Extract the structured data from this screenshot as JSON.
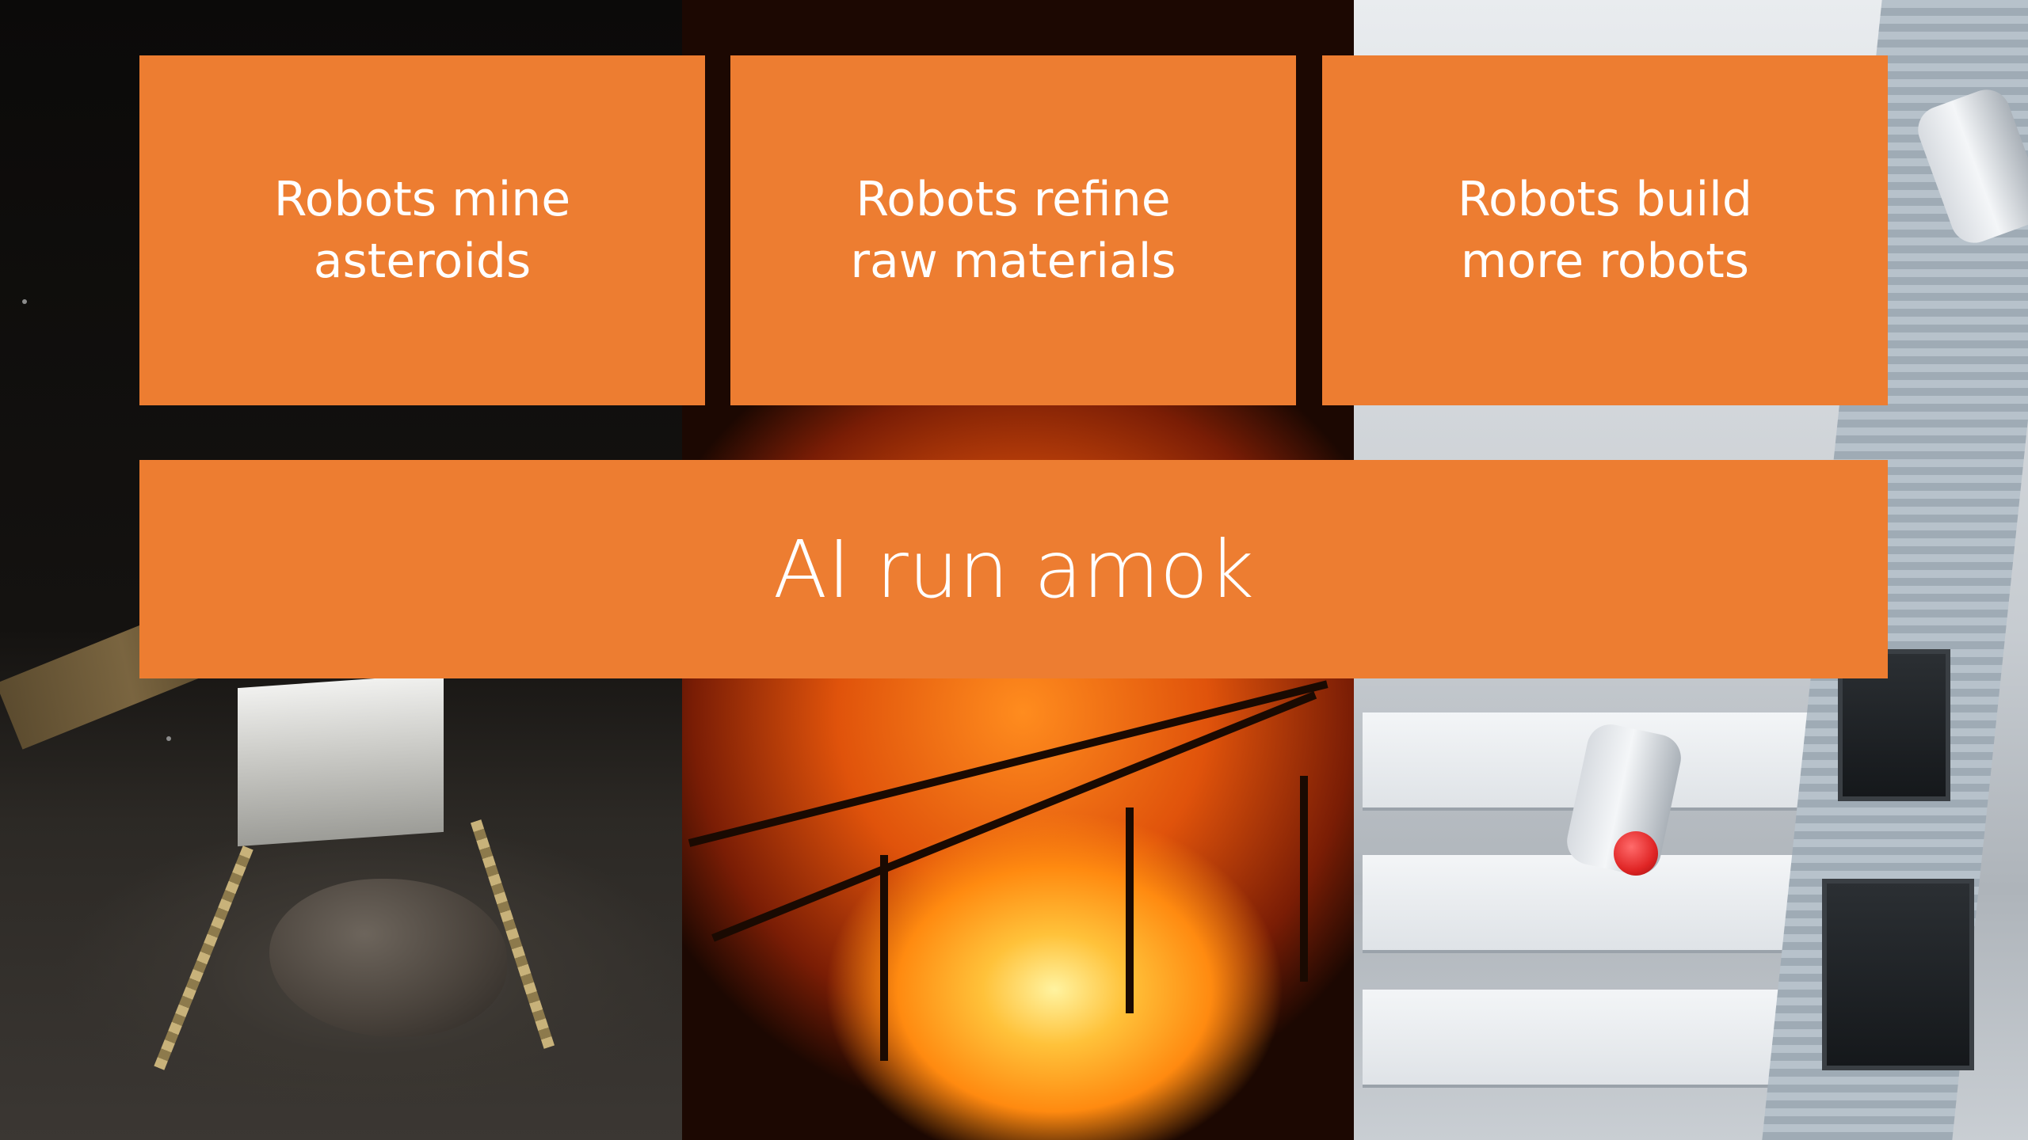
{
  "slide": {
    "tiles": [
      {
        "label": "Robots mine\nasteroids"
      },
      {
        "label": "Robots refine\nraw materials"
      },
      {
        "label": "Robots build\nmore robots"
      }
    ],
    "banner": {
      "label": "AI run amok"
    }
  },
  "colors": {
    "tile_fill": "#ED7D31",
    "tile_text": "#FFFFFF"
  },
  "background_images": [
    {
      "icon": "asteroid-mining-lander-image"
    },
    {
      "icon": "molten-metal-foundry-image"
    },
    {
      "icon": "robot-factory-assembly-line-image"
    }
  ]
}
